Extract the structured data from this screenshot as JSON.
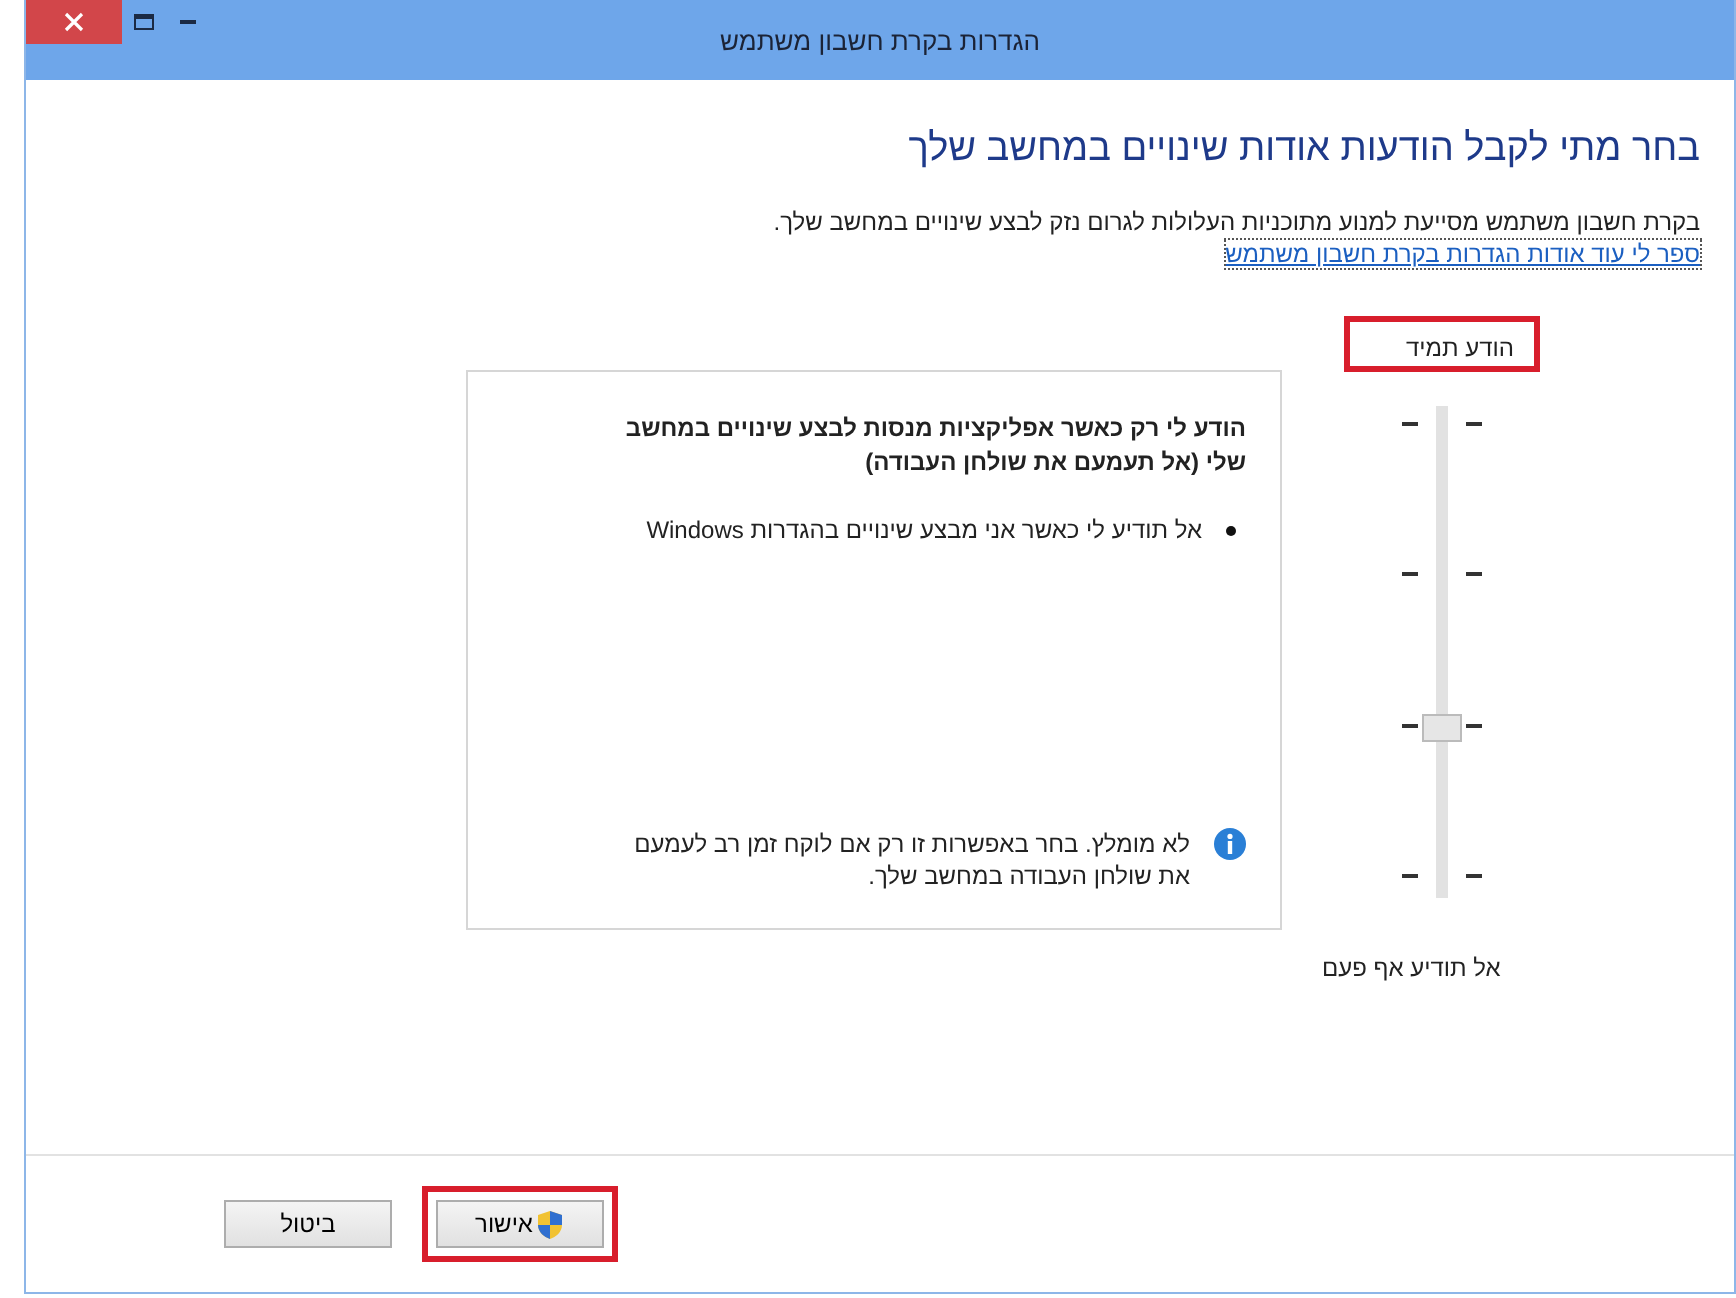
{
  "window": {
    "title": "הגדרות בקרת חשבון משתמש"
  },
  "heading": "בחר מתי לקבל הודעות אודות שינויים במחשב שלך",
  "description": "בקרת חשבון משתמש מסייעת למנוע מתוכניות העלולות לגרום נזק לבצע שינויים במחשב שלך.",
  "link": "ספר לי עוד אודות הגדרות בקרת חשבון משתמש",
  "slider": {
    "top_label": "הודע תמיד",
    "top_label_highlighted": true,
    "bottom_label": "אל תודיע אף פעם",
    "level": 0.333
  },
  "panel": {
    "title": "הודע לי רק כאשר אפליקציות מנסות לבצע שינויים במחשב שלי (אל תעמעם את שולחן העבודה)",
    "bullets": [
      "אל תודיע לי כאשר אני מבצע שינויים בהגדרות Windows"
    ],
    "note": "לא מומלץ. בחר באפשרות זו רק אם לוקח זמן רב לעמעם את שולחן העבודה במחשב שלך."
  },
  "buttons": [
    {
      "label": "אישור",
      "kind": "shield",
      "highlighted": true
    },
    {
      "label": "ביטול",
      "kind": "plain",
      "highlighted": false
    }
  ]
}
